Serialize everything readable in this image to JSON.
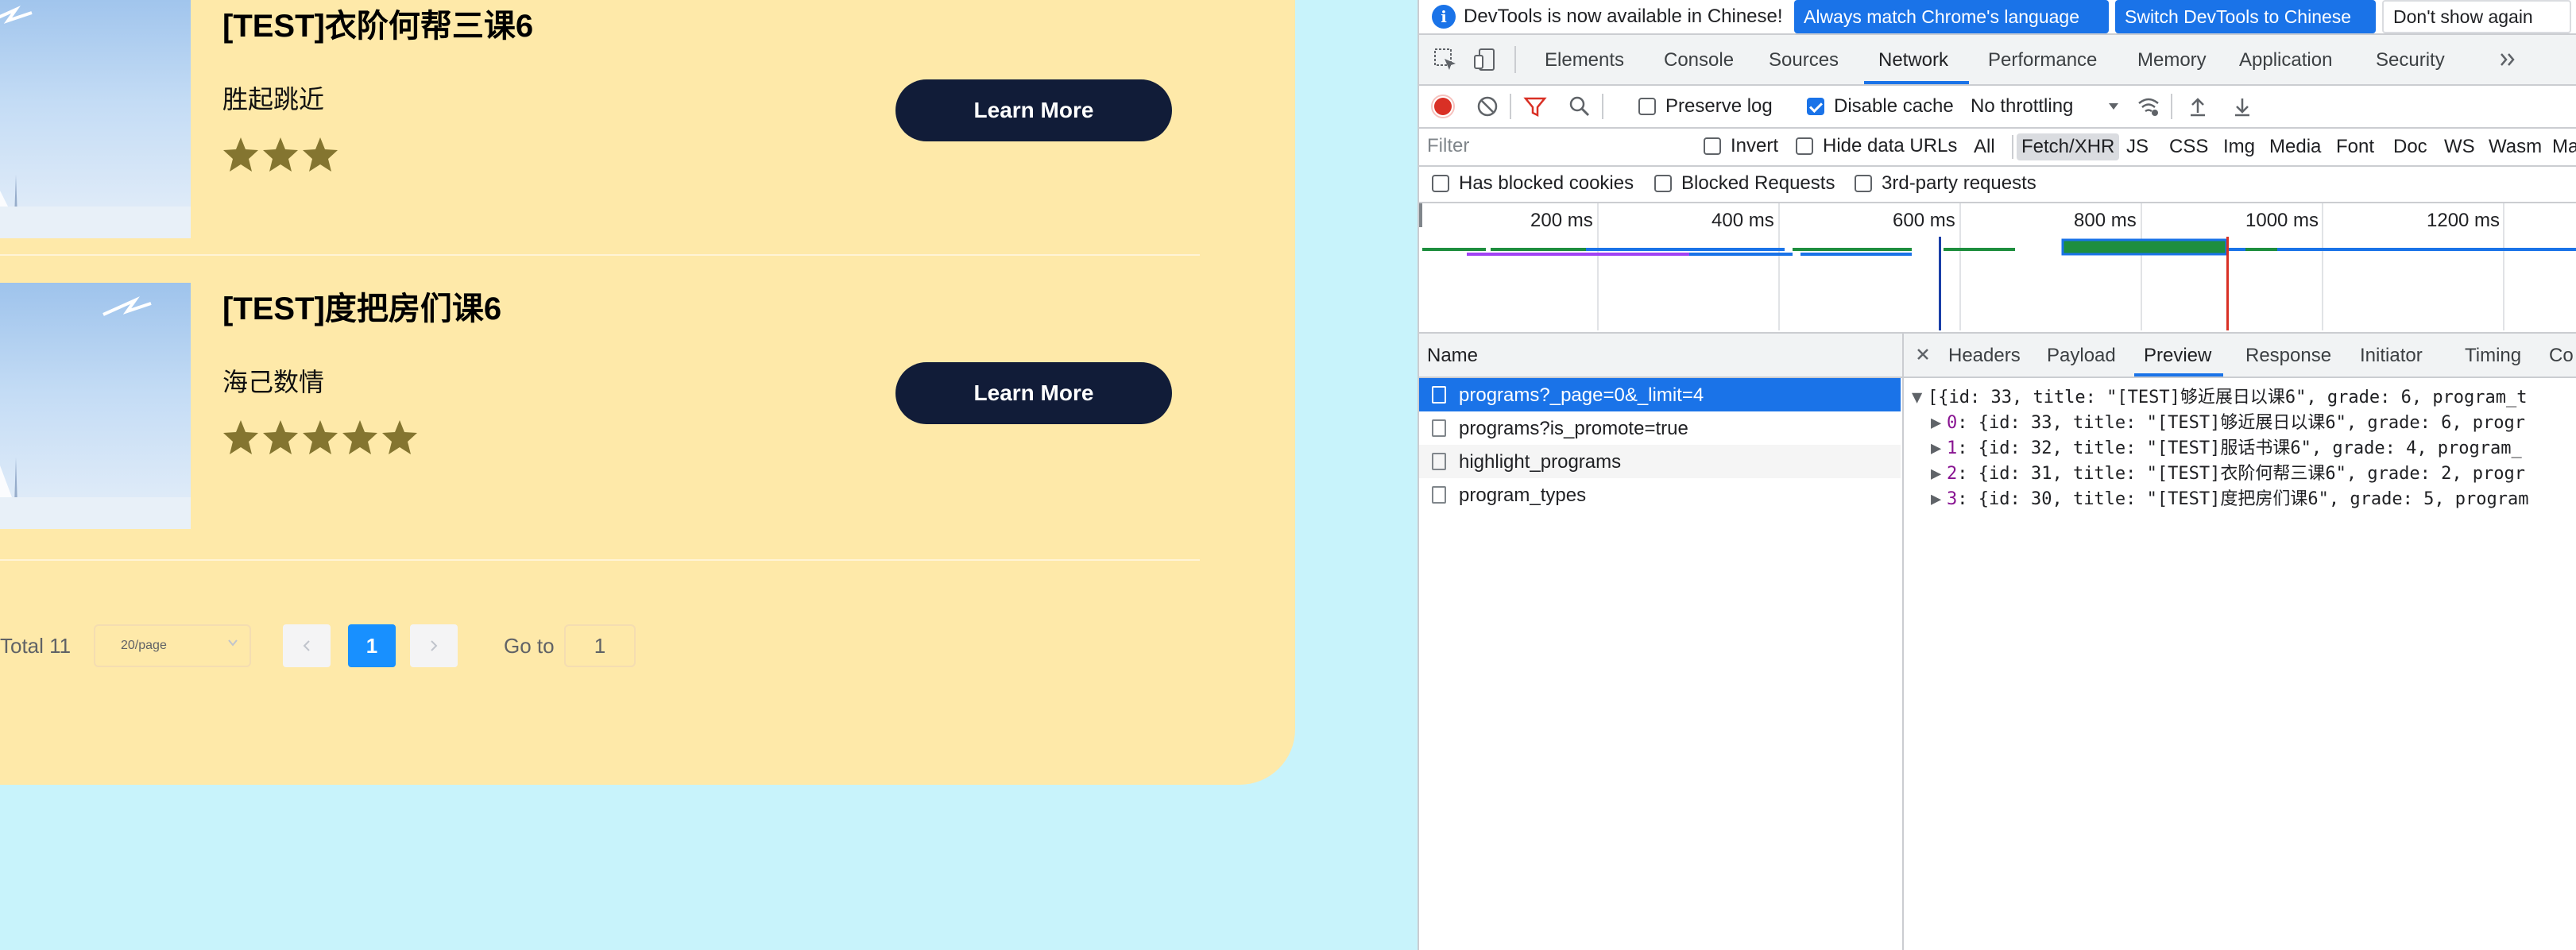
{
  "app": {
    "courses": [
      {
        "title": "[TEST]衣阶何帮三课6",
        "subtitle": "胜起跳近",
        "rating": 3,
        "button": "Learn More"
      },
      {
        "title": "[TEST]度把房们课6",
        "subtitle": "海己数情",
        "rating": 5,
        "button": "Learn More"
      }
    ],
    "pagination": {
      "total": "Total 11",
      "page_size": "20/page",
      "current_page": "1",
      "goto_label": "Go to",
      "goto_value": "1"
    }
  },
  "devtools": {
    "infobar": {
      "message": "DevTools is now available in Chinese!",
      "btn_match": "Always match Chrome's language",
      "btn_switch": "Switch DevTools to Chinese",
      "btn_dismiss": "Don't show again"
    },
    "tabs": [
      "Elements",
      "Console",
      "Sources",
      "Network",
      "Performance",
      "Memory",
      "Application",
      "Security"
    ],
    "active_tab": "Network",
    "toolbar": {
      "preserve_log": "Preserve log",
      "preserve_log_checked": false,
      "disable_cache": "Disable cache",
      "disable_cache_checked": true,
      "throttling": "No throttling"
    },
    "filter": {
      "placeholder": "Filter",
      "invert": "Invert",
      "hide_data_urls": "Hide data URLs",
      "types": [
        "All",
        "Fetch/XHR",
        "JS",
        "CSS",
        "Img",
        "Media",
        "Font",
        "Doc",
        "WS",
        "Wasm",
        "Ma"
      ],
      "selected_type": "Fetch/XHR"
    },
    "blocked": {
      "has_blocked_cookies": "Has blocked cookies",
      "blocked_requests": "Blocked Requests",
      "third_party": "3rd-party requests"
    },
    "timeline": {
      "ticks": [
        "200 ms",
        "400 ms",
        "600 ms",
        "800 ms",
        "1000 ms",
        "1200 ms"
      ]
    },
    "requests": {
      "header": "Name",
      "rows": [
        "programs?_page=0&_limit=4",
        "programs?is_promote=true",
        "highlight_programs",
        "program_types"
      ],
      "selected": 0
    },
    "detail": {
      "tabs": [
        "Headers",
        "Payload",
        "Preview",
        "Response",
        "Initiator",
        "Timing",
        "Co"
      ],
      "active_tab": "Preview",
      "preview": {
        "root": "[{id: 33, title: \"[TEST]够近展日以课6\", grade: 6, program_t",
        "items": [
          {
            "index": "0",
            "text": ": {id: 33, title: \"[TEST]够近展日以课6\", grade: 6, progr"
          },
          {
            "index": "1",
            "text": ": {id: 32, title: \"[TEST]服话书课6\", grade: 4, program_"
          },
          {
            "index": "2",
            "text": ": {id: 31, title: \"[TEST]衣阶何帮三课6\", grade: 2, progr"
          },
          {
            "index": "3",
            "text": ": {id: 30, title: \"[TEST]度把房们课6\", grade: 5, program"
          }
        ]
      }
    }
  }
}
